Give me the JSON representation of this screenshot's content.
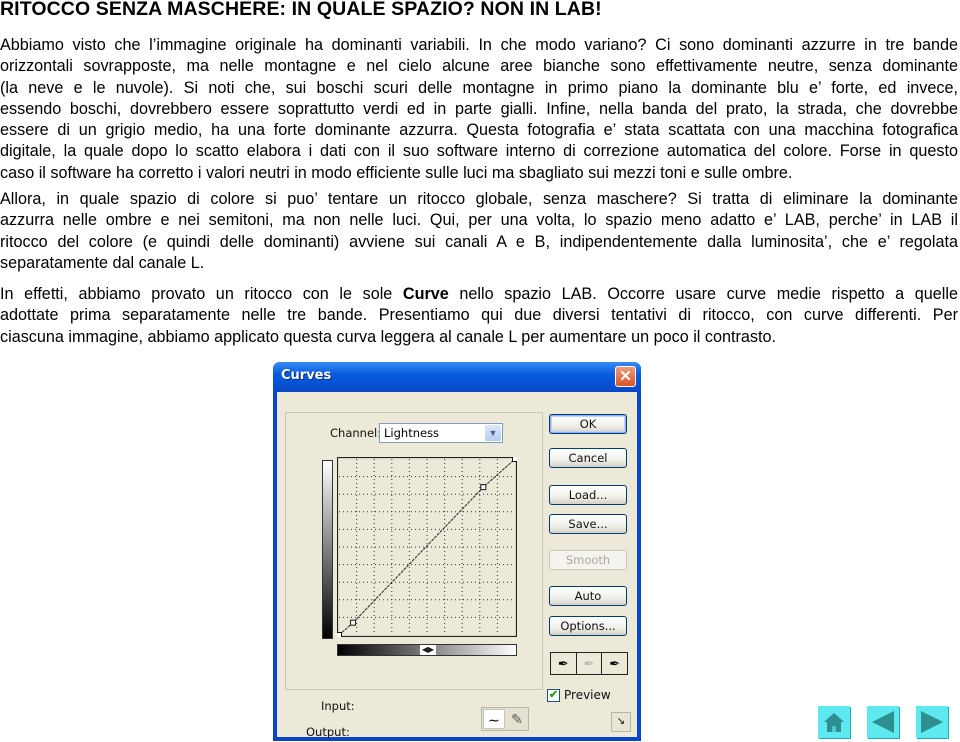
{
  "title": "RITOCCO SENZA MASCHERE: IN QUALE SPAZIO? NON IN LAB!",
  "paragraphs": {
    "p1": [
      "Abbiamo visto che l’immagine originale ha dominanti variabili. In che modo variano?  Ci sono dominanti azzurre in tre bande",
      "orizzontali sovrapposte, ma nelle montagne e nel cielo alcune aree bianche sono effettivamente neutre, senza dominante",
      "(la neve e le nuvole). Si noti che, sui boschi scuri delle montagne in primo piano la dominante blu e’ forte, ed invece,",
      "essendo boschi, dovrebbero essere soprattutto verdi ed in parte gialli. Infine, nella banda del prato, la strada, che dovrebbe",
      "essere di un grigio medio, ha una forte dominante azzurra. Questa fotografia e’ stata scattata con una macchina fotografica",
      "digitale, la quale dopo lo scatto elabora i dati con il suo software interno di correzione automatica del colore. Forse in questo",
      "caso il software ha corretto i valori neutri in modo efficiente sulle luci ma sbagliato sui mezzi toni e sulle ombre."
    ],
    "p2": [
      "Allora, in quale spazio di colore si puo’ tentare un ritocco globale, senza maschere? Si tratta di eliminare la dominante",
      "azzurra nelle ombre e nei semitoni, ma non nelle luci. Qui, per una volta, lo spazio meno adatto e’ LAB, perche’ in LAB il",
      "ritocco del colore (e quindi delle dominanti) avviene sui canali A e B, indipendentemente dalla luminosita’, che e’ regolata",
      "separatamente dal canale L."
    ],
    "p3": {
      "line1_before": "In effetti, abbiamo provato un ritocco con le sole ",
      "line1_bold": "Curve",
      "line1_after": " nello spazio LAB. Occorre usare curve medie rispetto a quelle",
      "line2": "adottate prima separatamente nelle tre bande. Presentiamo qui due diversi tentativi di ritocco, con curve differenti. Per",
      "line3": "ciascuna immagine, abbiamo applicato questa curva leggera al canale L per aumentare un poco il contrasto."
    }
  },
  "dialog": {
    "title": "Curves",
    "close_icon": "✕",
    "channel_label": "Channel:",
    "channel_value": "Lightness",
    "input_label": "Input:",
    "output_label": "Output:",
    "buttons": {
      "ok": "OK",
      "cancel": "Cancel",
      "load": "Load...",
      "save": "Save...",
      "smooth": "Smooth",
      "auto": "Auto",
      "options": "Options..."
    },
    "preview_label": "Preview",
    "preview_checked": true,
    "curve_points": [
      [
        0,
        0
      ],
      [
        0.08,
        0.07
      ],
      [
        0.82,
        0.84
      ],
      [
        1,
        1
      ]
    ],
    "grid_divisions": 10
  },
  "nav": {
    "home": "home-icon",
    "prev": "previous-page-icon",
    "next": "next-page-icon",
    "color": "#5ee8f0",
    "glyph_color": "#2d8f8f"
  }
}
